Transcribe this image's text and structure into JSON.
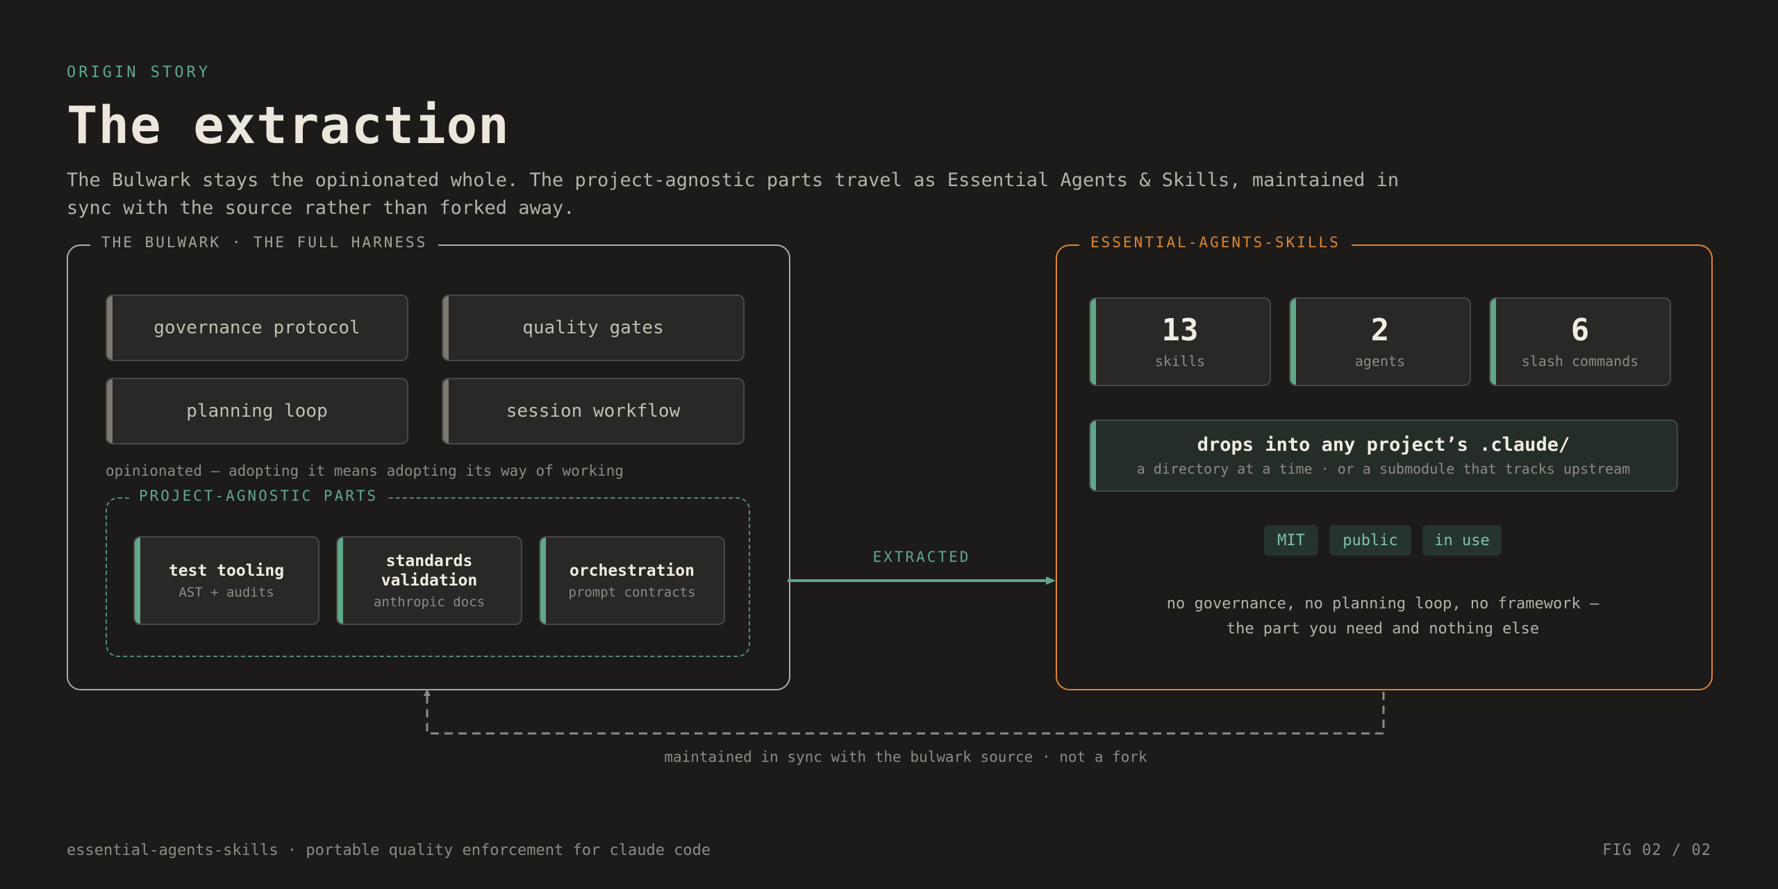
{
  "header": {
    "eyebrow": "ORIGIN STORY",
    "title": "The extraction",
    "subtitle": "The Bulwark stays the opinionated whole. The project-agnostic parts travel as Essential Agents & Skills, maintained in sync with the source rather than forked away."
  },
  "bulwark": {
    "label": "THE BULWARK · THE FULL HARNESS",
    "components": [
      "governance protocol",
      "quality gates",
      "planning loop",
      "session workflow"
    ],
    "note": "opinionated — adopting it means adopting its way of working",
    "agnostic": {
      "label": "PROJECT-AGNOSTIC PARTS",
      "items": [
        {
          "name": "test tooling",
          "detail": "AST + audits"
        },
        {
          "name": "standards validation",
          "detail": "anthropic docs"
        },
        {
          "name": "orchestration",
          "detail": "prompt contracts"
        }
      ]
    }
  },
  "arrow": {
    "label": "EXTRACTED"
  },
  "essential": {
    "label": "ESSENTIAL-AGENTS-SKILLS",
    "stats": [
      {
        "value": "13",
        "label": "skills"
      },
      {
        "value": "2",
        "label": "agents"
      },
      {
        "value": "6",
        "label": "slash commands"
      }
    ],
    "drop": {
      "title": "drops into any project’s .claude/",
      "detail": "a directory at a time · or a submodule that tracks upstream"
    },
    "badges": [
      "MIT",
      "public",
      "in use"
    ],
    "summary": [
      "no governance, no planning loop, no framework —",
      "the part you need and nothing else"
    ]
  },
  "sync_note": "maintained in sync with the bulwark source · not a fork",
  "footer": {
    "left": "essential-agents-skills · portable quality enforcement for claude code",
    "right": "FIG 02 / 02"
  },
  "colors": {
    "background": "#1c1b1a",
    "accent_green": "#5fa88a",
    "accent_orange": "#e0842f",
    "panel_border": "#b0aca3"
  }
}
